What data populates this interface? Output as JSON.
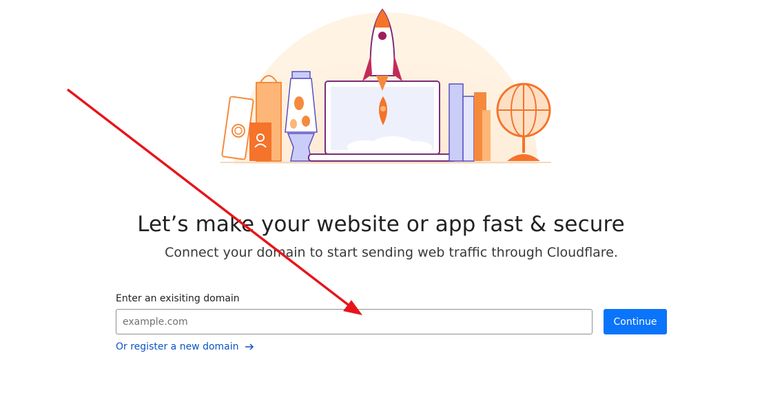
{
  "headline": "Let’s make your website or app fast & secure",
  "subheadline": "Connect your domain to start sending web traffic through Cloudflare.",
  "domain_form": {
    "label": "Enter an exisiting domain",
    "placeholder": "example.com",
    "value": "",
    "continue_label": "Continue",
    "register_label": "Or register a new domain"
  },
  "colors": {
    "primary_button": "#0a74fa",
    "link": "#0a55c2",
    "annotation_arrow": "#e8141b"
  },
  "icons": {
    "register_arrow": "arrow-right-icon",
    "hero": "rocket-launch-illustration"
  }
}
